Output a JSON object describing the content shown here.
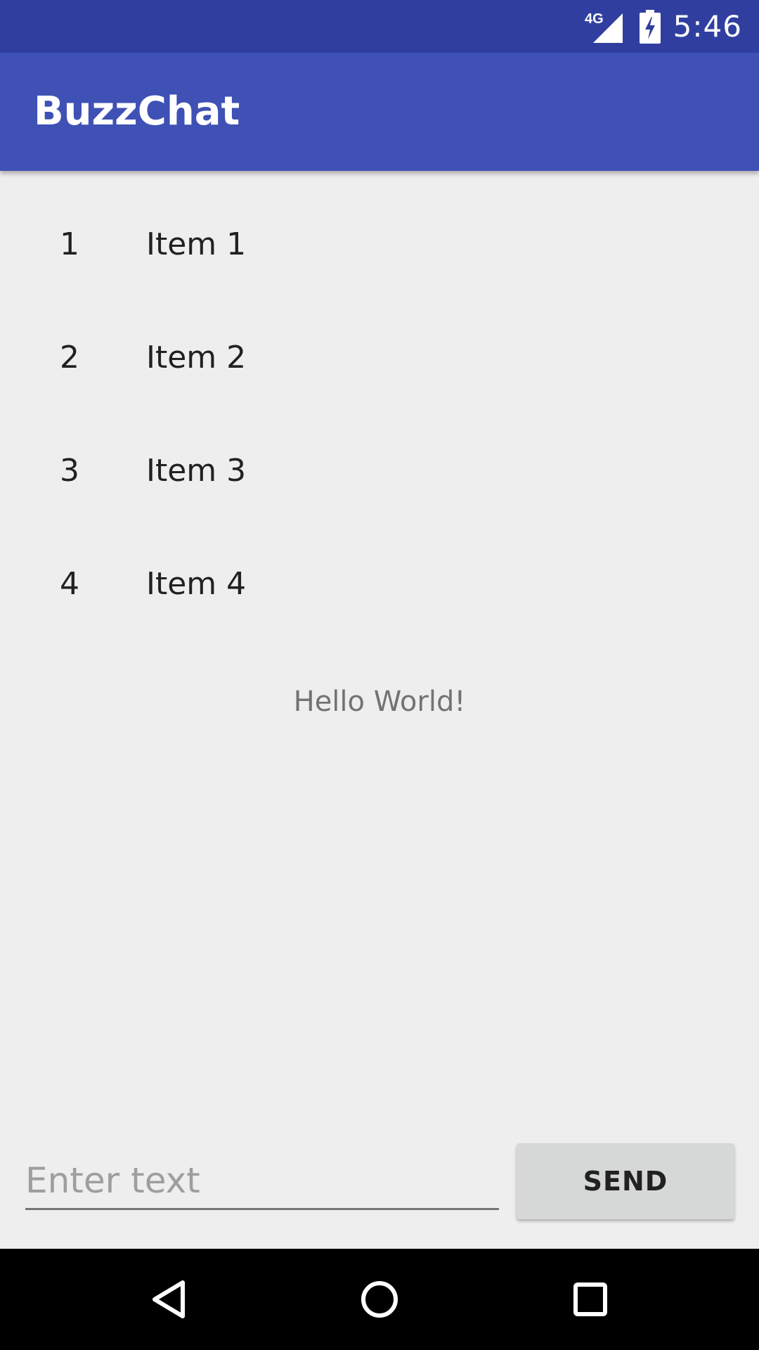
{
  "status_bar": {
    "network": "4G",
    "time": "5:46",
    "signal_icon": "signal-icon",
    "battery_icon": "battery-charging-icon"
  },
  "app_bar": {
    "title": "BuzzChat"
  },
  "list": {
    "items": [
      {
        "number": "1",
        "label": "Item 1"
      },
      {
        "number": "2",
        "label": "Item 2"
      },
      {
        "number": "3",
        "label": "Item 3"
      },
      {
        "number": "4",
        "label": "Item 4"
      }
    ]
  },
  "main": {
    "hello_text": "Hello World!"
  },
  "composer": {
    "placeholder": "Enter text",
    "value": "",
    "send_label": "SEND"
  },
  "nav_bar": {
    "back_icon": "back-icon",
    "home_icon": "home-icon",
    "recents_icon": "recents-icon"
  },
  "colors": {
    "status_bar": "#303f9f",
    "app_bar": "#3f51b5",
    "background": "#eeeeee",
    "button": "#d6d7d7"
  }
}
